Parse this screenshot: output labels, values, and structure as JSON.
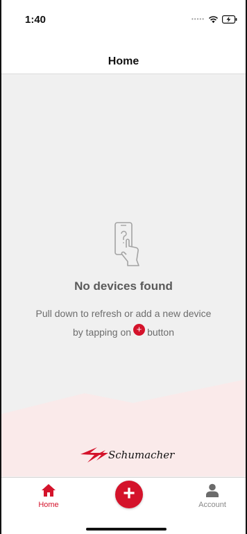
{
  "status_bar": {
    "time": "1:40",
    "signal_icon": "signal-dots-icon",
    "wifi_icon": "wifi-icon",
    "battery_icon": "battery-charging-icon"
  },
  "header": {
    "title": "Home"
  },
  "empty_state": {
    "icon": "phone-hand-question-icon",
    "title": "No devices found",
    "line1": "Pull down to refresh or add a new device",
    "line2_before": "by tapping on",
    "line2_after": "button",
    "plus_glyph": "+"
  },
  "brand": {
    "logo_text": "Schumacher",
    "color": "#d4132b"
  },
  "tab_bar": {
    "home_label": "Home",
    "add_glyph": "+",
    "account_label": "Account",
    "active_color": "#d4132b",
    "inactive_color": "#888888"
  }
}
